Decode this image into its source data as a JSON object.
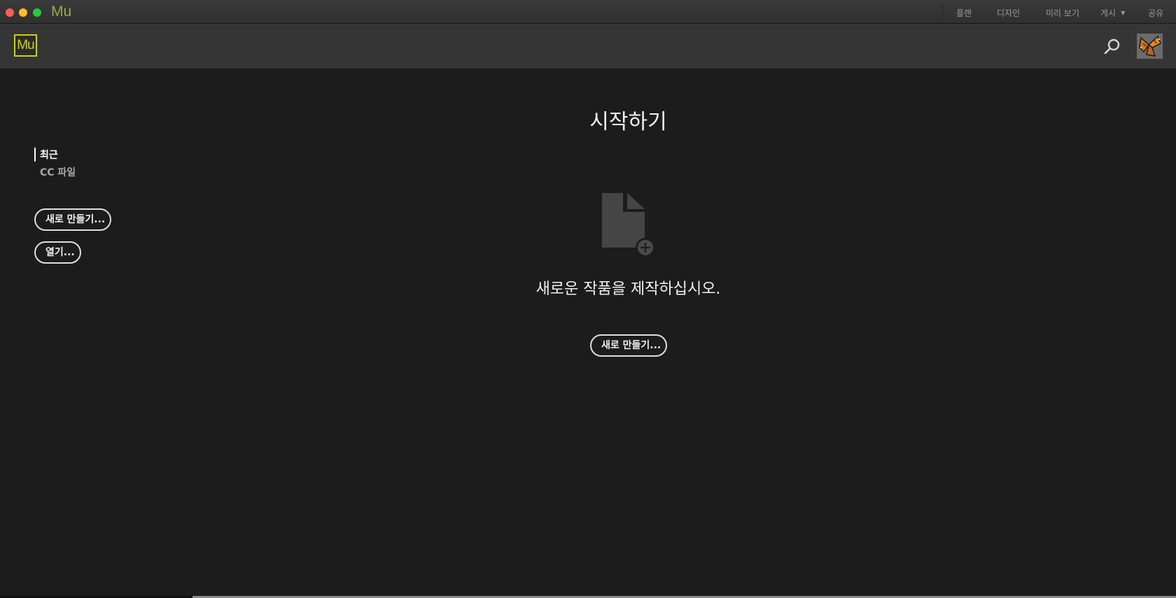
{
  "window": {
    "app_title": "Mu"
  },
  "top_menu": {
    "items": [
      "플랜",
      "디자인",
      "미리 보기",
      "게시",
      "공유"
    ],
    "publish_arrow": "▼"
  },
  "header": {
    "logo_text": "Mu",
    "search_icon": "search-icon",
    "avatar_icon": "butterfly-avatar"
  },
  "sidebar": {
    "recent_label": "최근",
    "cc_files_label": "CC 파일",
    "new_button": "새로 만들기...",
    "open_button": "열기..."
  },
  "main": {
    "title": "시작하기",
    "subtitle": "새로운 작품을 제작하십시오.",
    "new_button": "새로 만들기..."
  },
  "colors": {
    "background": "#1c1c1c",
    "header": "#353535",
    "logo_accent": "#c9d400",
    "title_accent": "#98a84a"
  }
}
